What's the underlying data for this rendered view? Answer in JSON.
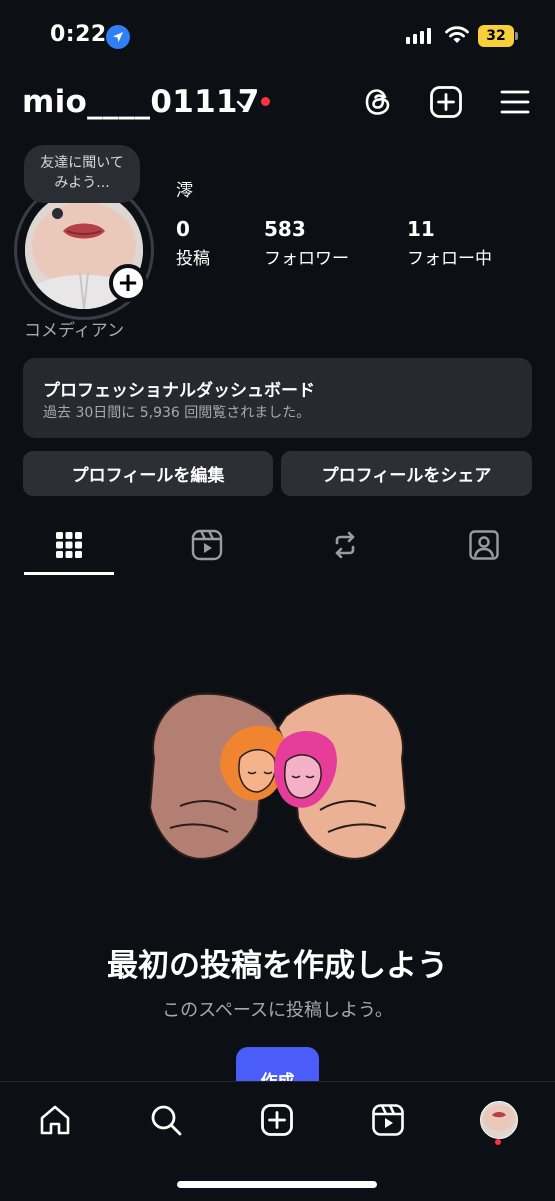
{
  "status_bar": {
    "time": "0:22",
    "battery": "32",
    "location_icon": "location-arrow-icon",
    "signal_icon": "cellular-signal-icon",
    "wifi_icon": "wifi-icon"
  },
  "header": {
    "username": "mio____01117",
    "icons": [
      "threads-icon",
      "create-plus-icon",
      "menu-icon"
    ],
    "notification_color": "#ff3040"
  },
  "profile": {
    "note_bubble": "友達に聞いて\nみよう...",
    "display_name": "澪",
    "category": "コメディアン",
    "stats": [
      {
        "value": "0",
        "label": "投稿"
      },
      {
        "value": "583",
        "label": "フォロワー"
      },
      {
        "value": "11",
        "label": "フォロー中"
      }
    ]
  },
  "dashboard": {
    "title": "プロフェッショナルダッシュボード",
    "subtitle": "過去 30日間に 5,936 回閲覧されました。"
  },
  "buttons": {
    "edit_profile": "プロフィールを編集",
    "share_profile": "プロフィールをシェア"
  },
  "tabs": [
    "grid-icon",
    "reels-icon",
    "reposts-icon",
    "tagged-icon"
  ],
  "empty_state": {
    "title": "最初の投稿を作成しよう",
    "subtitle": "このスペースに投稿しよう。",
    "create_label": "作成"
  },
  "bottom_nav": [
    "home-icon",
    "search-icon",
    "create-icon",
    "reels-icon",
    "profile-avatar"
  ],
  "colors": {
    "background": "#0c0f14",
    "accent": "#4a5df9",
    "card": "#26292f",
    "battery": "#f6cf3a"
  }
}
